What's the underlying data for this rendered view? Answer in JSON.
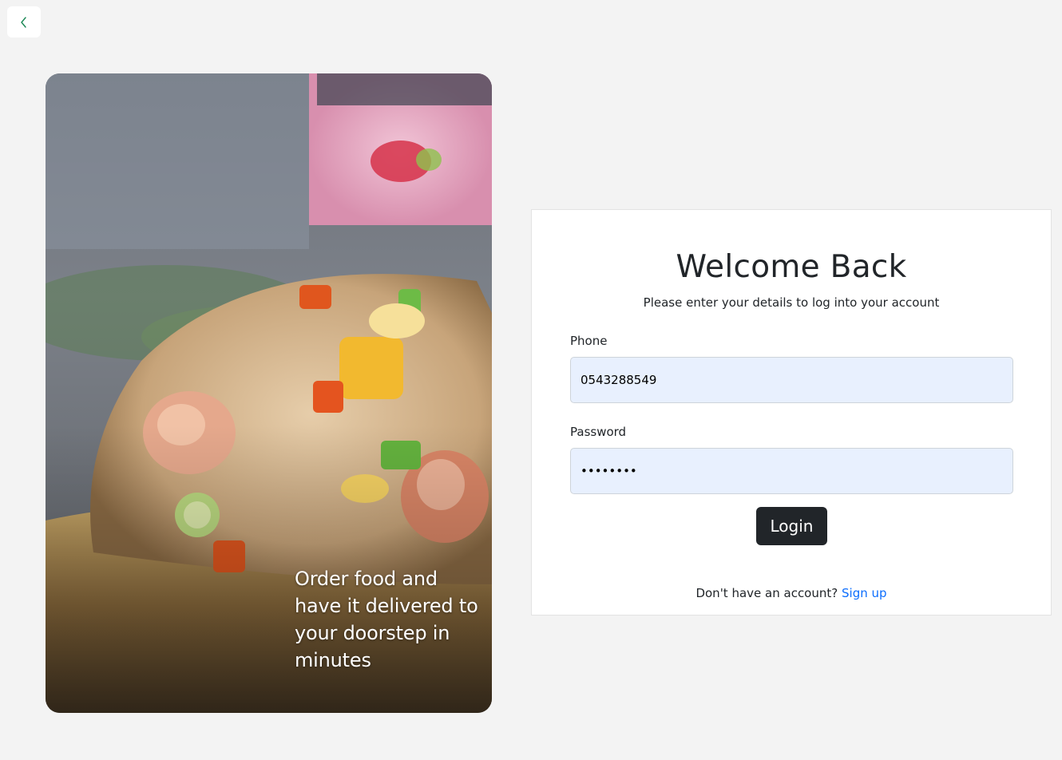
{
  "back_button": {
    "icon": "chevron-left-icon",
    "color": "#198754"
  },
  "hero": {
    "image": "food-photo-pineapple-fried-rice",
    "tagline": "Order food and have it delivered to your doorstep in minutes"
  },
  "login_card": {
    "title": "Welcome Back",
    "subtitle": "Please enter your details to log into your account",
    "phone_label": "Phone",
    "phone_value": "0543288549",
    "password_label": "Password",
    "password_value": "••••••••",
    "login_label": "Login",
    "signup_prompt": "Don't have an account?",
    "signup_link": "Sign up"
  },
  "colors": {
    "background": "#f3f3f3",
    "input_fill": "#e8f0fe",
    "button": "#212529",
    "link": "#0d6efd"
  }
}
